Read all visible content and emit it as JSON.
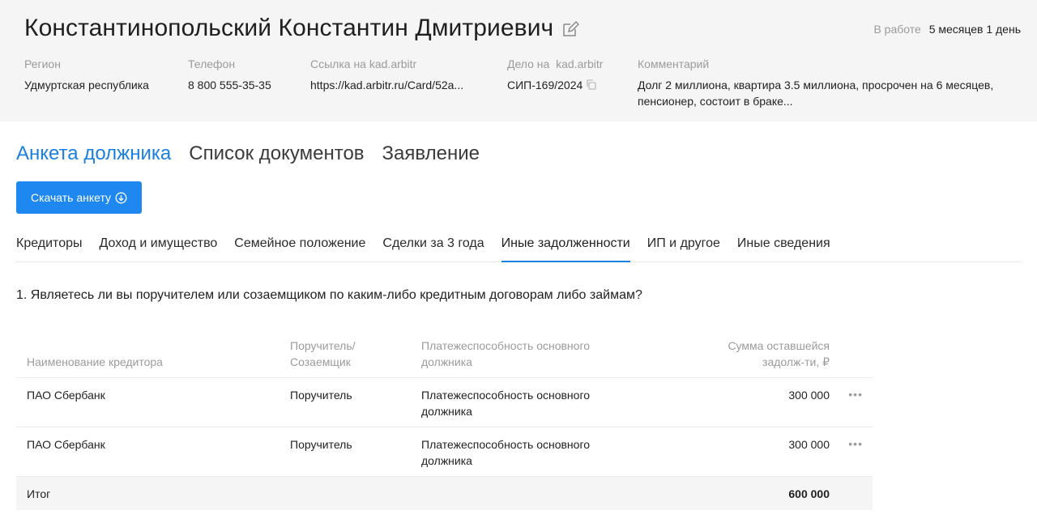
{
  "header": {
    "title": "Константинопольский Константин Дмитриевич",
    "status_label": "В работе",
    "status_value": "5 месяцев 1 день",
    "region_label": "Регион",
    "region_value": "Удмуртская республика",
    "phone_label": "Телефон",
    "phone_value": "8 800 555-35-35",
    "link_label": "Ссылка на kad.arbitr",
    "link_value": "https://kad.arbitr.ru/Card/52a...",
    "case_label": "Дело на  kad.arbitr",
    "case_value": "СИП-169/2024",
    "comment_label": "Комментарий",
    "comment_value": "Долг 2 миллиона, квартира 3.5 миллиона, просрочен на 6 месяцев, пенсионер, состоит в браке..."
  },
  "main_tabs": [
    {
      "label": "Анкета должника",
      "active": true
    },
    {
      "label": "Список документов",
      "active": false
    },
    {
      "label": "Заявление",
      "active": false
    }
  ],
  "download_button": "Скачать анкету",
  "sub_tabs": [
    {
      "label": "Кредиторы",
      "active": false
    },
    {
      "label": "Доход и имущество",
      "active": false
    },
    {
      "label": "Семейное положение",
      "active": false
    },
    {
      "label": "Сделки за 3 года",
      "active": false
    },
    {
      "label": "Иные задолженности",
      "active": true
    },
    {
      "label": "ИП и другое",
      "active": false
    },
    {
      "label": "Иные сведения",
      "active": false
    }
  ],
  "question": {
    "number": "1.",
    "text": "Являетесь ли вы поручителем или созаемщиком по каким-либо кредитным договорам либо займам?"
  },
  "table": {
    "headers": {
      "creditor": "Наименование кредитора",
      "role": "Поручитель/ Созаемщик",
      "solvency": "Платежеспособность основного должника",
      "amount": "Сумма оставшейся задолж-ти, ₽"
    },
    "rows": [
      {
        "creditor": "ПАО Сбербанк",
        "role": "Поручитель",
        "solvency": "Платежеспособность основного должника",
        "amount": "300 000"
      },
      {
        "creditor": "ПАО Сбербанк",
        "role": "Поручитель",
        "solvency": "Платежеспособность основного должника",
        "amount": "300 000"
      }
    ],
    "total_label": "Итог",
    "total_value": "600 000"
  },
  "icons": {
    "edit": "edit-pencil-icon",
    "copy": "copy-icon",
    "download": "download-circle-icon",
    "more": "more-dots-icon"
  },
  "colors": {
    "accent": "#1a7fe0",
    "button": "#1e88f0",
    "header_bg": "#f5f5f5",
    "muted": "#9b9b9b"
  }
}
